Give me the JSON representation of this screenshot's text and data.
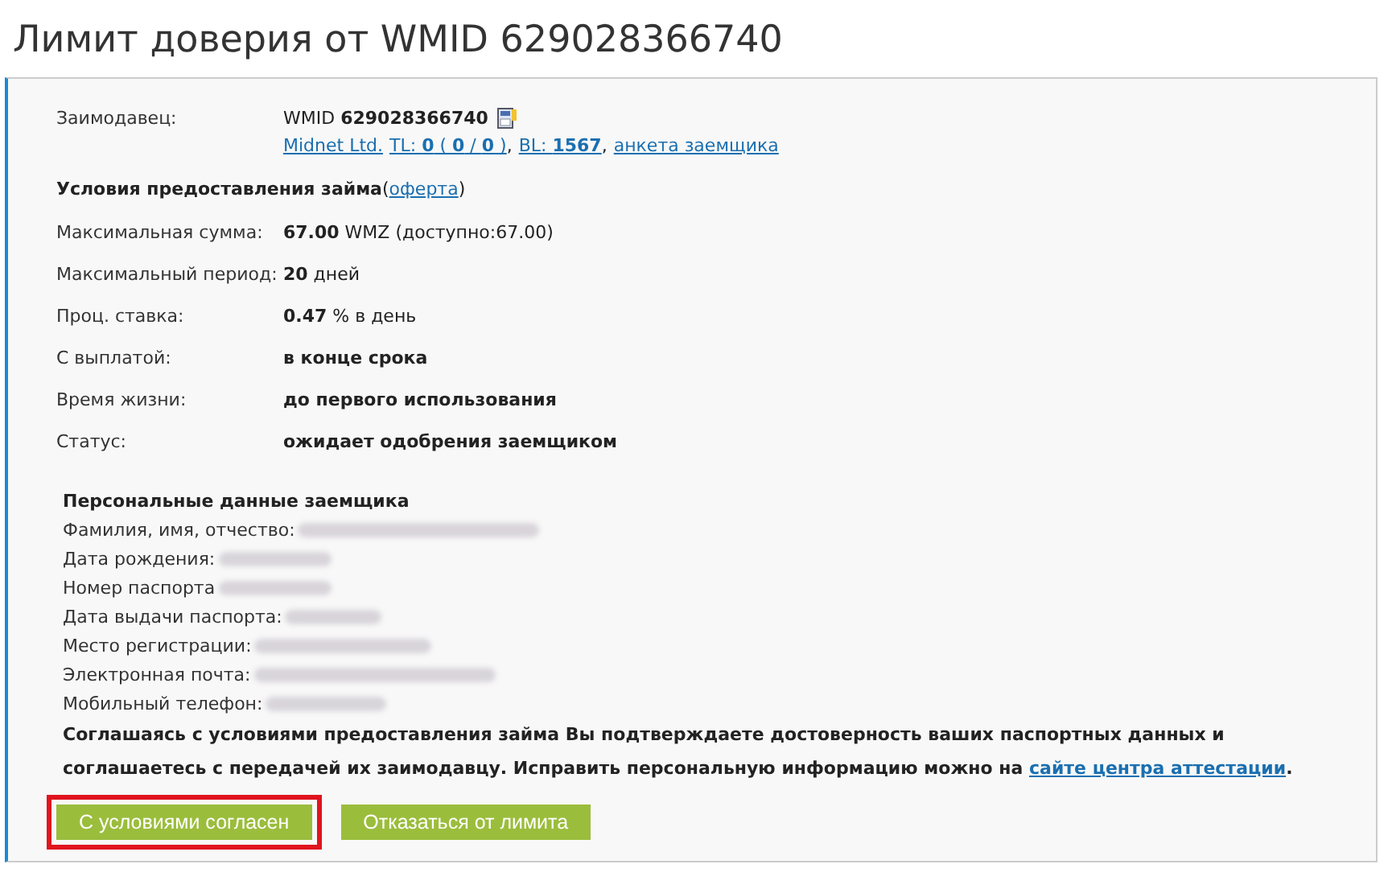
{
  "title": "Лимит доверия от WMID 629028366740",
  "lender": {
    "label": "Заимодавец:",
    "wmid": "WMID **629028366740**",
    "links": [
      {
        "text": "Midnet Ltd."
      },
      {
        "text": "TL: **0** ( **0** / **0** )",
        "sep": ","
      },
      {
        "text": "BL: **1567**",
        "sep": ","
      },
      {
        "text": "анкета заемщика"
      }
    ]
  },
  "terms": {
    "heading": "Условия предоставления займа",
    "link": "оферта",
    "open": "(",
    "close": ")",
    "rows": [
      {
        "label": "Максимальная сумма:",
        "value": "**67.00** WMZ (доступно:67.00)",
        "bold": false
      },
      {
        "label": "Максимальный период:",
        "value": "**20** дней",
        "bold": false
      },
      {
        "label": "Проц. ставка:",
        "value": "**0.47** % в день",
        "bold": false
      },
      {
        "label": "С выплатой:",
        "value": "в конце срока",
        "bold": true
      },
      {
        "label": "Время жизни:",
        "value": "до первого использования",
        "bold": true
      },
      {
        "label": "Статус:",
        "value": "ожидает одобрения заемщиком",
        "bold": true
      }
    ]
  },
  "personal": {
    "heading": "Персональные данные заемщика",
    "fields": [
      {
        "label": "Фамилия, имя, отчество:",
        "redacted": true
      },
      {
        "label": "Дата рождения:",
        "redacted": true
      },
      {
        "label": "Номер паспорта",
        "redacted": true
      },
      {
        "label": "Дата выдачи паспорта:",
        "redacted": true
      },
      {
        "label": "Место регистрации:",
        "redacted": true
      },
      {
        "label": "Электронная почта:",
        "redacted": true
      },
      {
        "label": "Мобильный телефон:",
        "redacted": true
      }
    ]
  },
  "consent": {
    "text": "Соглашаясь с условиями предоставления займа Вы подтверждаете достоверность ваших паспортных данных и соглашаетесь с передачей их заимодавцу. Исправить персональную информацию можно на ",
    "link": "сайте центра аттестации",
    "end": "."
  },
  "buttons": [
    {
      "label": "С условиями согласен",
      "highlighted": true
    },
    {
      "label": "Отказаться от лимита",
      "highlighted": false
    }
  ]
}
